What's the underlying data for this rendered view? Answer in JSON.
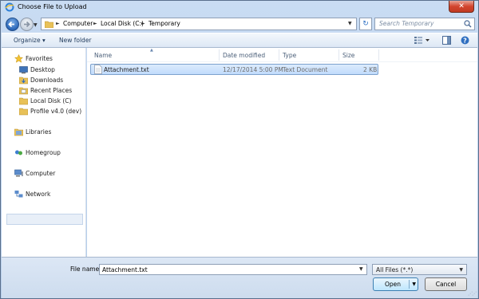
{
  "window": {
    "title": "Choose File to Upload",
    "close_label": "✕"
  },
  "address": {
    "crumbs": [
      "Computer",
      "Local Disk (C:)",
      "Temporary"
    ]
  },
  "search": {
    "placeholder": "Search Temporary"
  },
  "toolbar": {
    "organize_label": "Organize ▾",
    "new_folder_label": "New folder"
  },
  "nav": {
    "favorites_label": "Favorites",
    "favorites": [
      "Desktop",
      "Downloads",
      "Recent Places",
      "Local Disk (C)",
      "Profile v4.0 (dev)"
    ],
    "libraries_label": "Libraries",
    "homegroup_label": "Homegroup",
    "computer_label": "Computer",
    "network_label": "Network"
  },
  "columns": [
    "Name",
    "Date modified",
    "Type",
    "Size"
  ],
  "files": [
    {
      "name": "Attachment.txt",
      "date": "12/17/2014 5:00 PM",
      "type": "Text Document",
      "size": "2 KB"
    }
  ],
  "bottom": {
    "filename_label": "File name:",
    "filename_value": "Attachment.txt",
    "filetype_value": "All Files (*.*)",
    "open_label": "Open",
    "cancel_label": "Cancel"
  },
  "icons": {
    "back": "arrow-left-icon",
    "forward": "arrow-right-icon",
    "folder": "folder-icon",
    "refresh": "refresh-icon",
    "search": "search-icon",
    "views": "view-options-icon",
    "preview": "preview-pane-icon",
    "help": "help-icon",
    "txt": "text-file-icon"
  },
  "colors": {
    "accent": "#2a66b8",
    "selection": "#c1dbfc",
    "close": "#d2452e"
  }
}
